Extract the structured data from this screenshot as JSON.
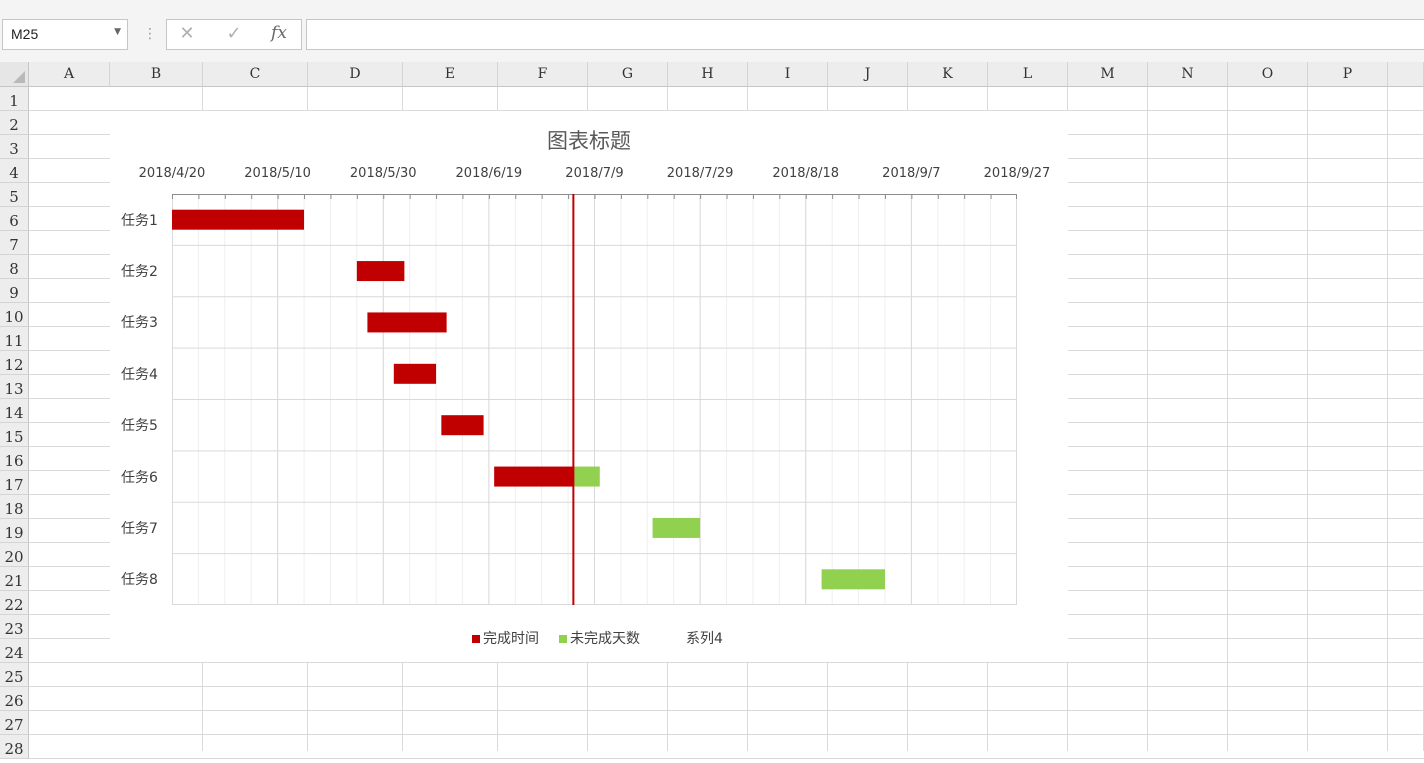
{
  "name_box": {
    "value": "M25"
  },
  "formula_bar": {
    "cancel_icon": "✕",
    "enter_icon": "✓",
    "fx_label": "fx",
    "content": ""
  },
  "sheet": {
    "columns": [
      "A",
      "B",
      "C",
      "D",
      "E",
      "F",
      "G",
      "H",
      "I",
      "J",
      "K",
      "L",
      "M",
      "N",
      "O",
      "P"
    ],
    "rows": [
      "1",
      "2",
      "3",
      "4",
      "5",
      "6",
      "7",
      "8",
      "9",
      "10",
      "11",
      "12",
      "13",
      "14",
      "15",
      "16",
      "17",
      "18",
      "19",
      "20",
      "21",
      "22",
      "23",
      "24",
      "25",
      "26",
      "27",
      "28"
    ]
  },
  "chart_data": {
    "type": "gantt",
    "title": "图表标题",
    "x_axis_position": "top",
    "x_tick_labels": [
      "2018/4/20",
      "2018/5/10",
      "2018/5/30",
      "2018/6/19",
      "2018/7/9",
      "2018/7/29",
      "2018/8/18",
      "2018/9/7",
      "2018/9/27"
    ],
    "x_range": [
      "2018/4/20",
      "2018/9/27"
    ],
    "gridlines": true,
    "today_line": "2018/7/5",
    "categories": [
      "任务1",
      "任务2",
      "任务3",
      "任务4",
      "任务5",
      "任务6",
      "任务7",
      "任务8"
    ],
    "series": [
      {
        "name": "完成时间",
        "color": "#c00000",
        "bars": [
          {
            "task": "任务1",
            "start": "2018/4/20",
            "end": "2018/5/15"
          },
          {
            "task": "任务2",
            "start": "2018/5/25",
            "end": "2018/6/3"
          },
          {
            "task": "任务3",
            "start": "2018/5/27",
            "end": "2018/6/11"
          },
          {
            "task": "任务4",
            "start": "2018/6/1",
            "end": "2018/6/9"
          },
          {
            "task": "任务5",
            "start": "2018/6/10",
            "end": "2018/6/18"
          },
          {
            "task": "任务6",
            "start": "2018/6/20",
            "end": "2018/7/5"
          }
        ]
      },
      {
        "name": "未完成天数",
        "color": "#92d050",
        "bars": [
          {
            "task": "任务6",
            "start": "2018/7/5",
            "end": "2018/7/10"
          },
          {
            "task": "任务7",
            "start": "2018/7/20",
            "end": "2018/7/29"
          },
          {
            "task": "任务8",
            "start": "2018/8/21",
            "end": "2018/9/2"
          }
        ]
      },
      {
        "name": "系列4",
        "color": "#ffffff",
        "bars": []
      }
    ],
    "legend_position": "bottom"
  }
}
